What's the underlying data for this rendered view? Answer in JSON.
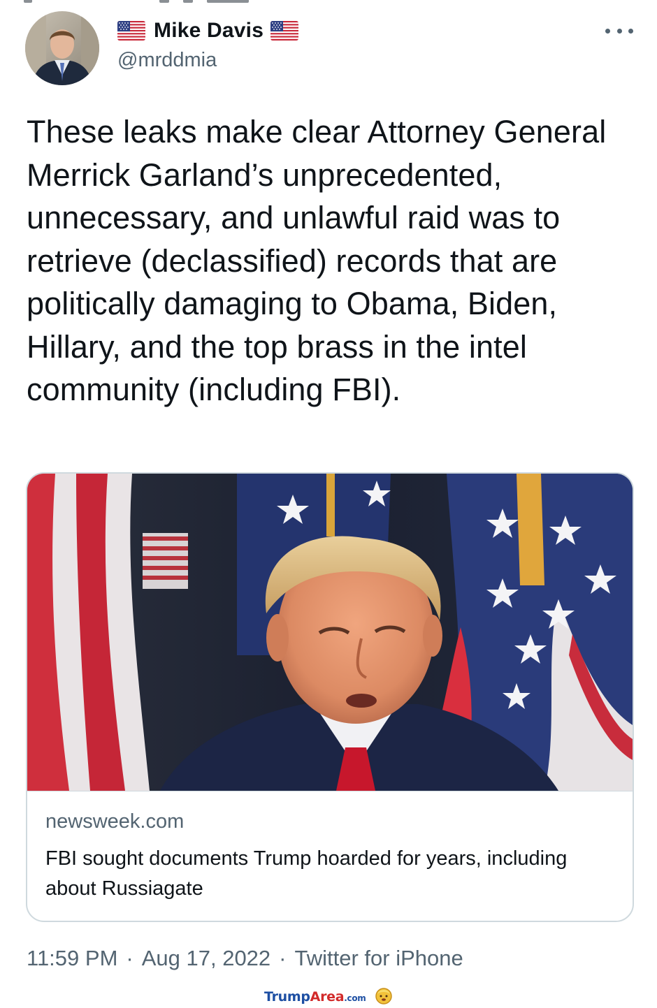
{
  "author": {
    "display_name": "Mike Davis",
    "handle": "@mrddmia",
    "name_prefix_icon": "us-flag-icon",
    "name_suffix_icon": "us-flag-icon"
  },
  "menu": {
    "icon": "more-options-icon"
  },
  "tweet": {
    "text": "These leaks make clear Attorney General Merrick Garland’s unprecedented, unnecessary, and unlawful raid was to retrieve (declassified) records that are politically damaging to Obama, Biden, Hillary, and the top brass in the intel community (including FBI)."
  },
  "link_card": {
    "domain": "newsweek.com",
    "title": "FBI sought documents Trump hoarded for years, including about Russiagate"
  },
  "meta": {
    "time": "11:59 PM",
    "date": "Aug 17, 2022",
    "source": "Twitter for iPhone",
    "separator": "·"
  },
  "watermark": {
    "part1": "Trump",
    "part2": "Area",
    "part3": ".com"
  },
  "colors": {
    "text": "#0f1419",
    "secondary": "#536471",
    "border": "#cfd9de",
    "watermark_blue": "#1d4fa3",
    "watermark_red": "#d22a2a"
  }
}
